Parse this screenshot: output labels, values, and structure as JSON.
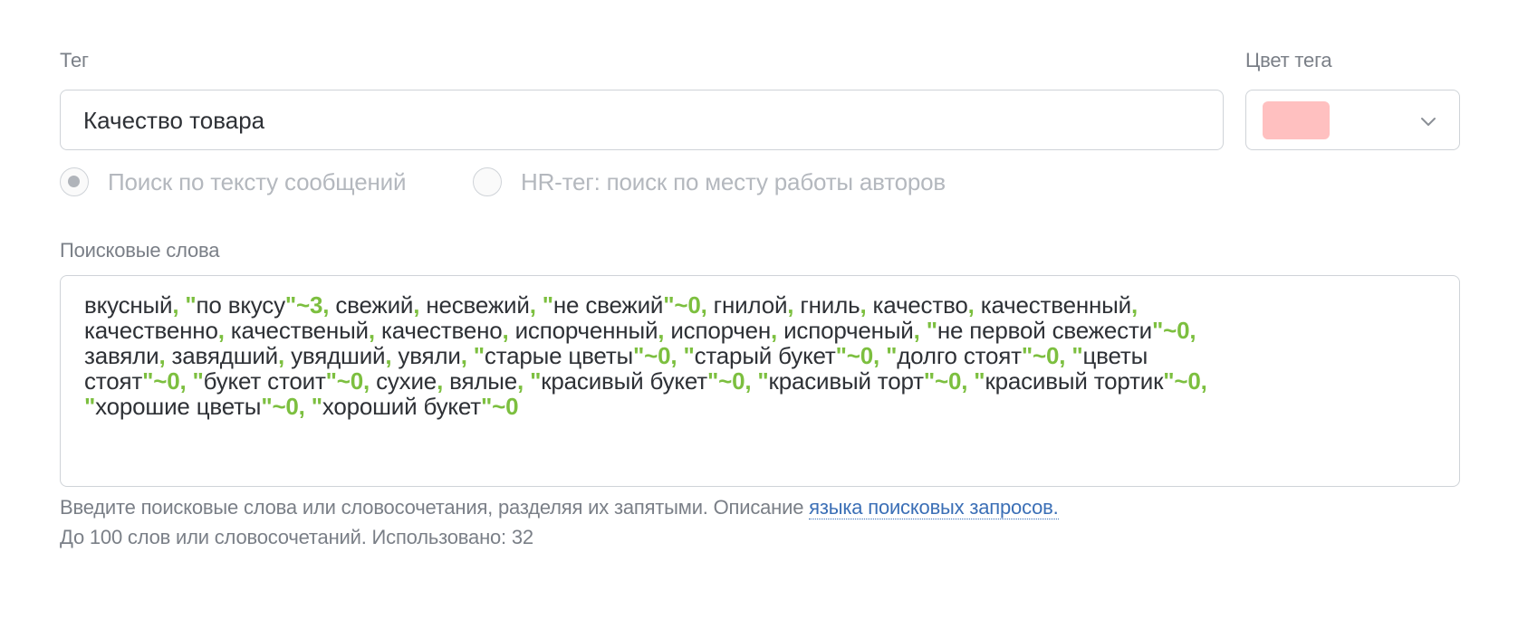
{
  "tag": {
    "label": "Тег",
    "value": "Качество товара"
  },
  "color": {
    "label": "Цвет тега",
    "swatch": "#ffc0c0"
  },
  "search_mode": {
    "options": [
      {
        "label": "Поиск по тексту сообщений",
        "selected": true
      },
      {
        "label": "HR-тег: поиск по месту работы авторов",
        "selected": false
      }
    ]
  },
  "keywords": {
    "label": "Поисковые слова",
    "lines": [
      [
        {
          "t": "вкусный"
        },
        {
          "o": ", \""
        },
        {
          "t": "по вкусу"
        },
        {
          "o": "\"~3, "
        },
        {
          "t": "свежий"
        },
        {
          "o": ", "
        },
        {
          "t": "несвежий"
        },
        {
          "o": ", \""
        },
        {
          "t": "не свежий"
        },
        {
          "o": "\"~0, "
        },
        {
          "t": "гнилой"
        },
        {
          "o": ", "
        },
        {
          "t": "гниль"
        },
        {
          "o": ", "
        },
        {
          "t": "качество"
        },
        {
          "o": ", "
        },
        {
          "t": "качественный"
        },
        {
          "o": ","
        }
      ],
      [
        {
          "t": "качественно"
        },
        {
          "o": ", "
        },
        {
          "t": "качественый"
        },
        {
          "o": ", "
        },
        {
          "t": "качествено"
        },
        {
          "o": ", "
        },
        {
          "t": "испорченный"
        },
        {
          "o": ", "
        },
        {
          "t": "испорчен"
        },
        {
          "o": ", "
        },
        {
          "t": "испорченый"
        },
        {
          "o": ", \""
        },
        {
          "t": "не первой свежести"
        },
        {
          "o": "\"~0,"
        }
      ],
      [
        {
          "t": "завяли"
        },
        {
          "o": ", "
        },
        {
          "t": "завядший"
        },
        {
          "o": ", "
        },
        {
          "t": "увядший"
        },
        {
          "o": ", "
        },
        {
          "t": "увяли"
        },
        {
          "o": ", \""
        },
        {
          "t": "старые цветы"
        },
        {
          "o": "\"~0, \""
        },
        {
          "t": "старый букет"
        },
        {
          "o": "\"~0, \""
        },
        {
          "t": "долго стоят"
        },
        {
          "o": "\"~0, \""
        },
        {
          "t": "цветы"
        }
      ],
      [
        {
          "t": "стоят"
        },
        {
          "o": "\"~0, \""
        },
        {
          "t": "букет стоит"
        },
        {
          "o": "\"~0, "
        },
        {
          "t": "сухие"
        },
        {
          "o": ", "
        },
        {
          "t": "вялые"
        },
        {
          "o": ", \""
        },
        {
          "t": "красивый букет"
        },
        {
          "o": "\"~0, \""
        },
        {
          "t": "красивый торт"
        },
        {
          "o": "\"~0, \""
        },
        {
          "t": "красивый тортик"
        },
        {
          "o": "\"~0,"
        }
      ],
      [
        {
          "o": "\""
        },
        {
          "t": "хорошие цветы"
        },
        {
          "o": "\"~0, \""
        },
        {
          "t": "хороший букет"
        },
        {
          "o": "\"~0"
        }
      ]
    ]
  },
  "hint": {
    "line1_prefix": "Введите поисковые слова или словосочетания, разделяя их запятыми. Описание ",
    "link_text": "языка поисковых запросов.",
    "line2": "До 100 слов или словосочетаний. Использовано: 32"
  },
  "icons": {
    "chevron": "chevron-down-icon"
  }
}
